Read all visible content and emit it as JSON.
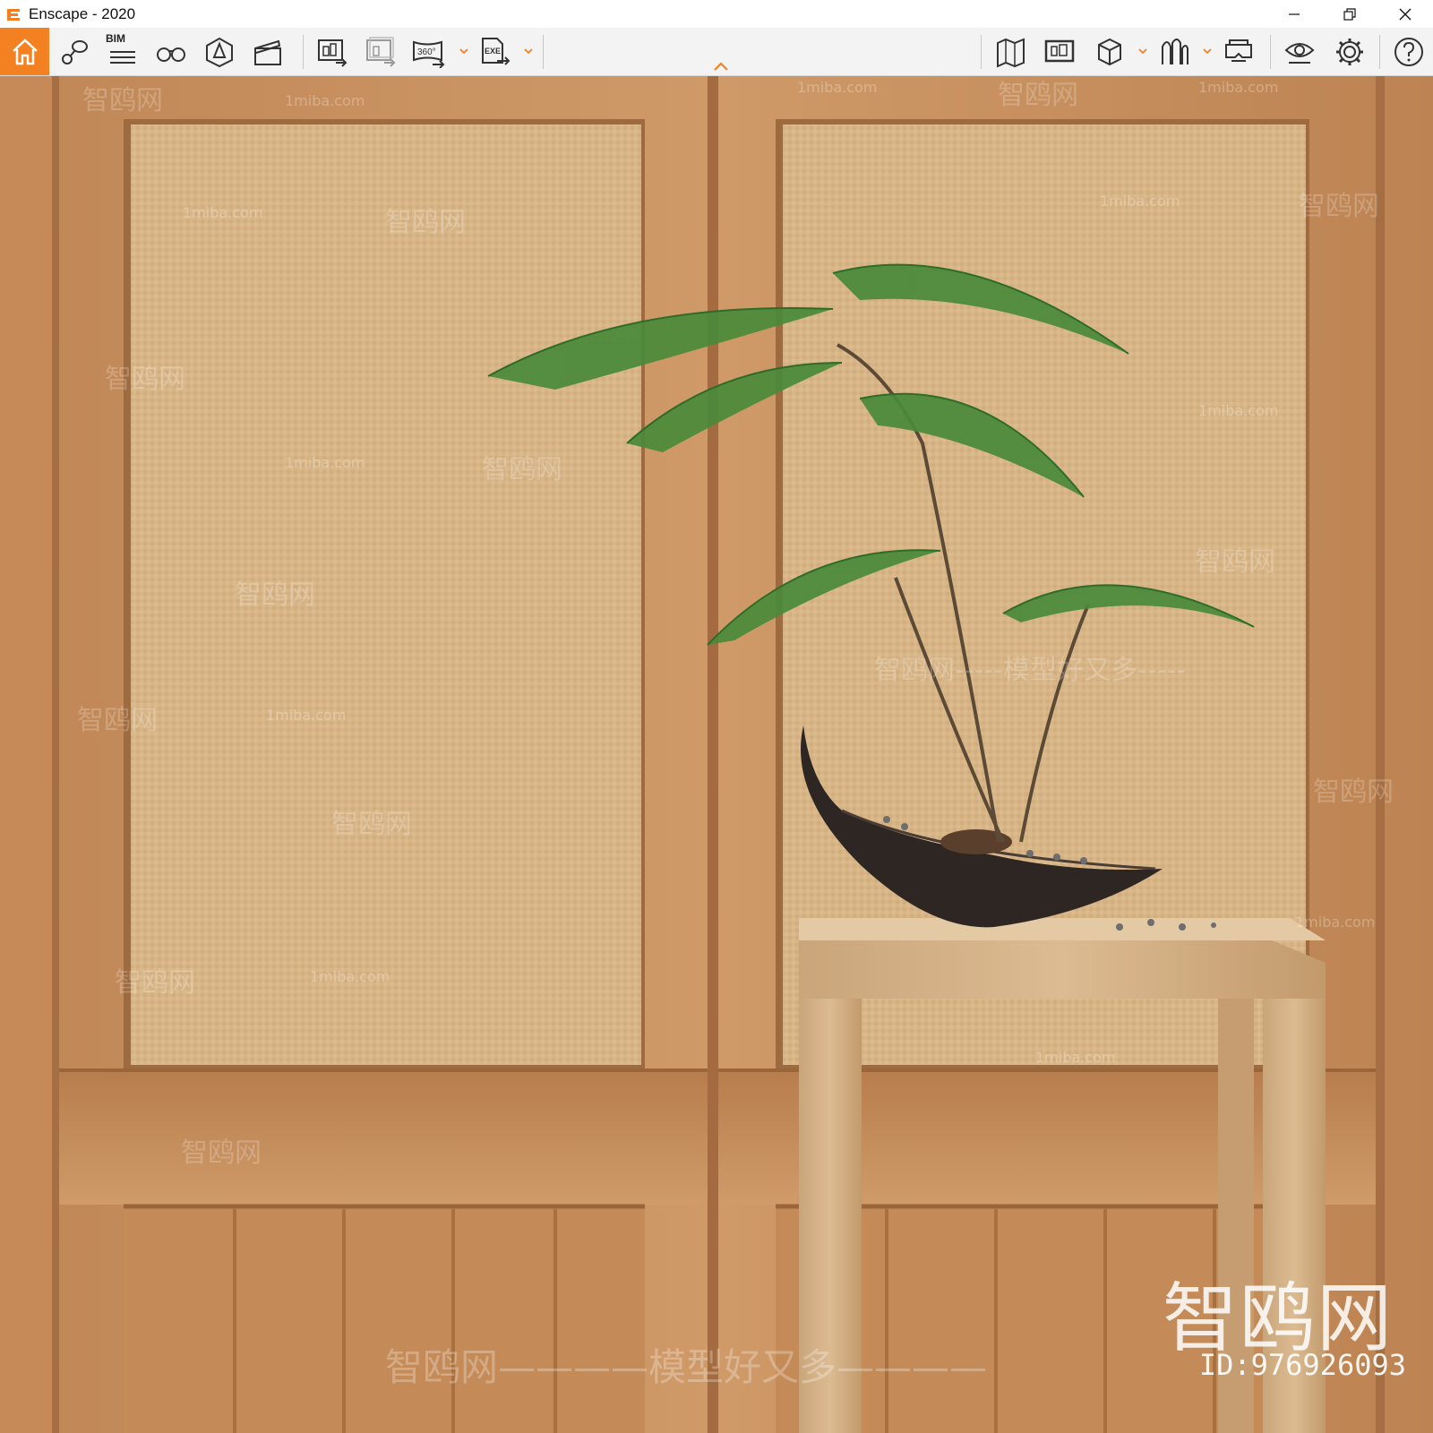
{
  "window": {
    "title": "Enscape - 2020",
    "controls": {
      "minimize": "minimize-icon",
      "restore": "restore-icon",
      "close": "close-icon"
    }
  },
  "toolbar": {
    "accent": "#f38121",
    "bim_label": "BIM",
    "left_buttons": [
      "home-icon",
      "tag-icon",
      "bim-icon",
      "binoculars-icon",
      "asset-library-icon",
      "clapperboard-icon",
      "screenshot-export-icon",
      "batch-export-icon",
      "panorama-360-icon",
      "exe-export-icon"
    ],
    "right_buttons": [
      "map-icon",
      "view-management-icon",
      "cube-icon",
      "vegetation-icon",
      "vr-headset-icon",
      "visual-settings-icon",
      "settings-icon",
      "help-icon"
    ]
  },
  "viewport": {
    "watermarks": {
      "domain": "1miba.com",
      "cn_brand": "智鸥网",
      "slogan": "智鸥网-----模型好又多-----",
      "slogan_center": "智鸥网————模型好又多————"
    },
    "brand_mark": "智鸥网",
    "id_label": "ID:976926093"
  },
  "scene": {
    "wood_color": "#c8915f",
    "panel_color": "#d6b385",
    "plant_color": "#4a8a3a",
    "pot_color": "#2e2622",
    "stand_color": "#d8b48a"
  }
}
